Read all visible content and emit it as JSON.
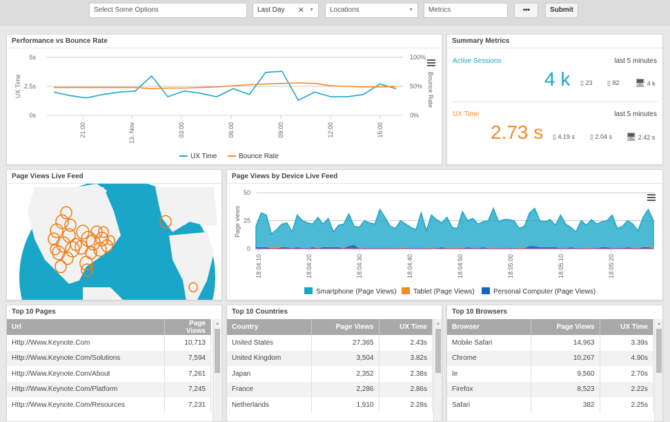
{
  "toolbar": {
    "options_placeholder": "Select Some Options",
    "time_range": "Last Day",
    "locations_placeholder": "Locations",
    "metrics_placeholder": "Metrics",
    "more_label": "●●●",
    "submit_label": "Submit"
  },
  "perf_panel": {
    "title": "Performance vs Bounce Rate"
  },
  "summary": {
    "title": "Summary Metrics",
    "sessions": {
      "label": "Active Sessions",
      "window": "last 5 minutes",
      "value": "4 k",
      "tablet": "23",
      "smartphone": "82",
      "desktop": "4 k"
    },
    "uxtime": {
      "label": "UX Time",
      "window": "last 5 minutes",
      "value": "2.73 s",
      "tablet": "4.19 s",
      "smartphone": "2.04 s",
      "desktop": "2.42 s"
    },
    "colors": {
      "sessions": "#1aa6c8",
      "uxtime": "#f58a25"
    }
  },
  "map_panel": {
    "title": "Page Views Live Feed"
  },
  "device_panel": {
    "title": "Page Views by Device Live Feed"
  },
  "chart_data": [
    {
      "type": "line",
      "title": "Performance vs Bounce Rate",
      "xlabel": "",
      "ylabel": "UX Time",
      "y2label": "Bounce Rate",
      "x_ticks": [
        "21:00",
        "13. Nov",
        "03:00",
        "06:00",
        "09:00",
        "12:00",
        "15:00"
      ],
      "y_ticks": [
        "0s",
        "2.5s",
        "5s"
      ],
      "y2_ticks": [
        "0%",
        "50%",
        "100%"
      ],
      "ylim": [
        0,
        5
      ],
      "y2lim": [
        0,
        100
      ],
      "grid": true,
      "legend": "bottom",
      "series": [
        {
          "name": "UX Time",
          "color": "#1aa6c8",
          "axis": "left",
          "values": [
            2.0,
            1.7,
            1.5,
            1.8,
            2.0,
            2.1,
            3.4,
            1.6,
            2.1,
            1.9,
            1.6,
            2.3,
            1.8,
            3.7,
            3.8,
            1.3,
            2.0,
            1.6,
            1.6,
            1.8,
            2.7,
            2.3
          ]
        },
        {
          "name": "Bounce Rate",
          "color": "#f58a25",
          "axis": "right",
          "values": [
            48,
            48,
            48,
            48,
            48,
            48,
            46,
            47,
            47,
            48,
            49,
            51,
            53,
            54,
            55,
            56,
            55,
            51,
            50,
            49,
            49,
            50
          ]
        }
      ]
    },
    {
      "type": "area",
      "title": "Page Views by Device Live Feed",
      "xlabel": "",
      "ylabel": "Page views",
      "x_ticks": [
        "18:04:10",
        "18:04:20",
        "18:04:30",
        "18:04:40",
        "18:04:50",
        "18:05:00",
        "18:05:10",
        "18:05:20"
      ],
      "y_ticks": [
        "0",
        "25",
        "50"
      ],
      "ylim": [
        0,
        50
      ],
      "grid": true,
      "legend": "bottom",
      "series": [
        {
          "name": "Smartphone (Page Views)",
          "color": "#1aa6c8",
          "values": [
            20,
            32,
            30,
            13,
            17,
            22,
            23,
            15,
            30,
            25,
            23,
            22,
            28,
            22,
            27,
            15,
            21,
            22,
            31,
            20,
            19,
            25,
            23,
            22,
            35,
            28,
            20,
            18,
            25,
            22,
            19,
            17,
            32,
            16,
            30,
            26,
            23,
            28,
            19,
            18,
            33,
            25,
            27,
            22,
            24,
            25,
            36,
            24,
            26,
            26,
            25,
            18,
            20,
            32,
            36,
            25,
            24,
            26,
            21,
            30,
            22,
            19,
            15,
            25,
            21,
            26,
            22,
            24,
            25,
            30,
            18,
            20,
            25,
            22,
            16,
            28,
            35,
            25
          ]
        },
        {
          "name": "Tablet (Page Views)",
          "color": "#f58a25",
          "values": [
            0,
            0,
            1,
            1,
            2,
            1,
            0,
            0,
            1,
            0,
            0,
            1,
            1,
            0,
            1,
            0,
            0,
            1,
            2,
            1,
            1,
            0,
            0,
            0,
            0,
            0,
            0,
            0,
            1,
            0,
            0,
            0,
            0,
            0,
            1,
            0,
            0,
            1,
            0,
            1,
            1,
            0,
            0,
            0,
            0,
            0,
            1,
            0,
            0,
            0,
            0,
            1,
            1,
            0,
            0,
            1,
            0,
            0,
            1,
            0,
            0,
            0,
            0,
            0,
            1,
            0,
            0,
            0,
            1,
            0,
            0,
            0,
            1,
            1,
            0,
            1,
            2,
            1
          ]
        },
        {
          "name": "Personal Computer (Page Views)",
          "color": "#1565c0",
          "values": [
            1,
            1,
            1,
            0,
            0,
            1,
            1,
            0,
            1,
            0,
            0,
            1,
            0,
            1,
            1,
            1,
            1,
            0,
            2,
            3,
            0,
            0,
            0,
            0,
            0,
            0,
            0,
            0,
            0,
            0,
            0,
            0,
            0,
            0,
            0,
            0,
            1,
            0,
            0,
            0,
            0,
            1,
            0,
            0,
            1,
            0,
            0,
            0,
            0,
            0,
            0,
            0,
            0,
            2,
            2,
            1,
            1,
            1,
            1,
            0,
            0,
            1,
            0,
            0,
            0,
            0,
            0,
            1,
            1,
            0,
            0,
            0,
            1,
            0,
            0,
            1,
            1,
            0
          ]
        }
      ]
    }
  ],
  "pages_table": {
    "title": "Top 10 Pages",
    "columns": [
      "Url",
      "Page Views"
    ],
    "rows": [
      [
        "Http://Www.Keynote.Com",
        "10,713"
      ],
      [
        "Http://Www.Keynote.Com/Solutions",
        "7,594"
      ],
      [
        "Http://Www.Keynote.Com/About",
        "7,261"
      ],
      [
        "Http://Www.Keynote.Com/Platform",
        "7,245"
      ],
      [
        "Http://Www.Keynote.Com/Resources",
        "7,231"
      ]
    ]
  },
  "countries_table": {
    "title": "Top 10 Countries",
    "columns": [
      "Country",
      "Page Views",
      "UX Time"
    ],
    "rows": [
      [
        "United States",
        "27,365",
        "2.43s"
      ],
      [
        "United Kingdom",
        "3,504",
        "3.82s"
      ],
      [
        "Japan",
        "2,352",
        "2.38s"
      ],
      [
        "France",
        "2,286",
        "2.86s"
      ],
      [
        "Netherlands",
        "1,910",
        "2.28s"
      ]
    ]
  },
  "browsers_table": {
    "title": "Top 10 Browsers",
    "columns": [
      "Browser",
      "Page Views",
      "UX Time"
    ],
    "rows": [
      [
        "Mobile Safari",
        "14,963",
        "3.39s"
      ],
      [
        "Chrome",
        "10,267",
        "4.90s"
      ],
      [
        "Ie",
        "9,560",
        "2.70s"
      ],
      [
        "Firefox",
        "8,523",
        "2.22s"
      ],
      [
        "Safari",
        "382",
        "2.25s"
      ]
    ]
  }
}
